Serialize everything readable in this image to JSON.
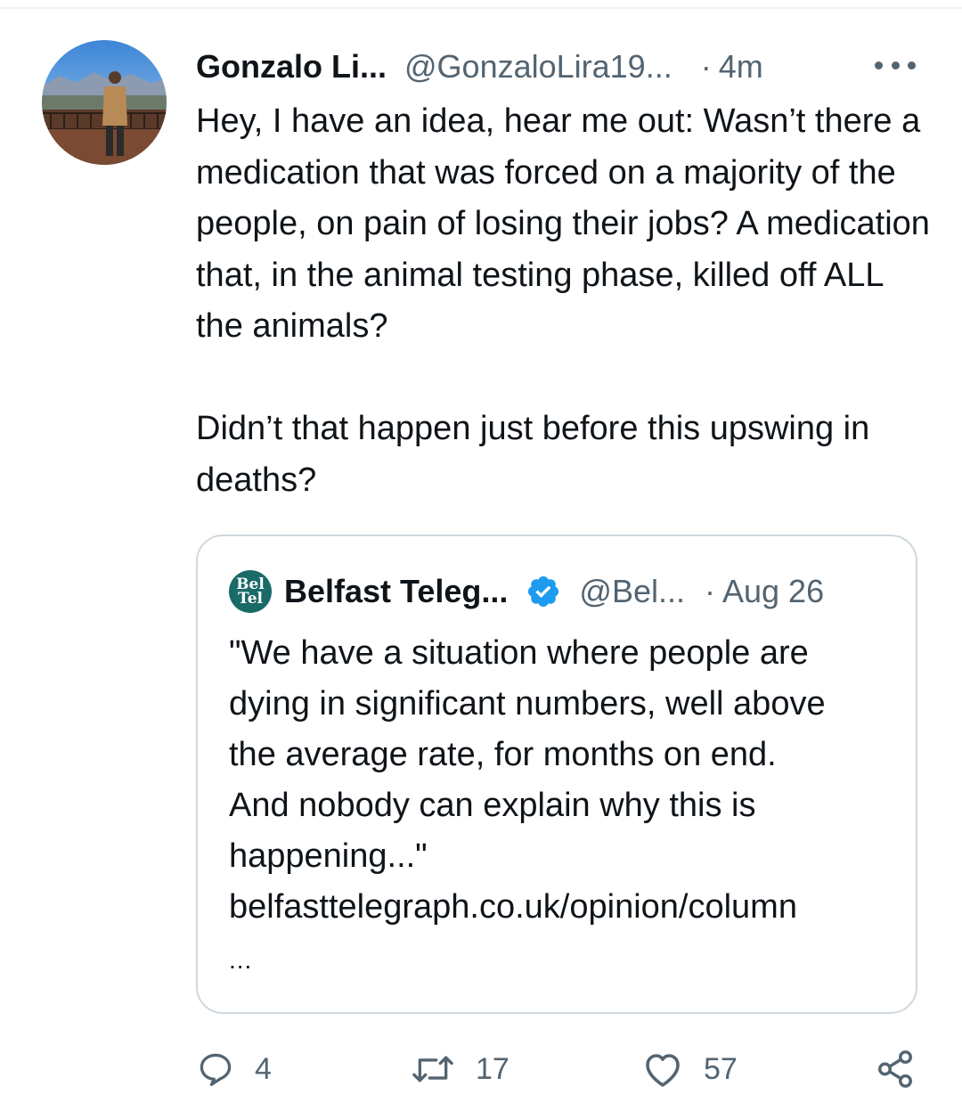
{
  "tweet": {
    "author_name": "Gonzalo Li...",
    "author_handle": "@GonzaloLira19...",
    "time_separator": "·",
    "time": "4m",
    "paragraphs": [
      "Hey, I have an idea, hear me out: Wasn’t there a medication that was forced on a majority of the people, on pain of losing their jobs? A medication that, in the animal testing phase, killed off ALL the animals?",
      "Didn’t that happen just before this upswing in deaths?"
    ],
    "avatar_icon": "profile-photo"
  },
  "quoted_tweet": {
    "logo_lines": [
      "Bel",
      "Tel"
    ],
    "author_name": "Belfast Teleg...",
    "verified_icon": "verified-badge-icon",
    "author_handle": "@Bel...",
    "time_separator": "·",
    "time": "Aug 26",
    "text_lines": [
      "\"We have a situation where people are",
      "dying in significant numbers, well above",
      "the average rate, for months on end.",
      "And nobody can explain why this is",
      "happening...\"",
      "belfasttelegraph.co.uk/opinion/column"
    ],
    "truncation": "..."
  },
  "actions": {
    "reply_count": "4",
    "retweet_count": "17",
    "like_count": "57"
  },
  "colors": {
    "text_primary": "#0f1419",
    "text_secondary": "#536471",
    "border": "#cfd9de",
    "verified": "#1d9bf0",
    "logo_bg": "#1a6a68"
  }
}
